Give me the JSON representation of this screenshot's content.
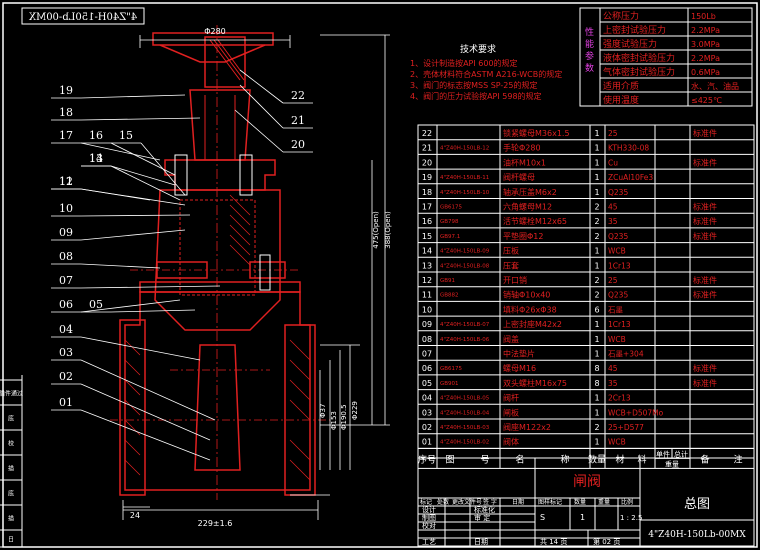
{
  "drawing_code": "4\"Z40H-150Lb-00MX",
  "drawing_code_mirrored": "4\"Z40H-150Lb-00MX",
  "tech_req": {
    "title": "技术要求",
    "items": [
      "1、设计制造按API 600的规定",
      "2、壳体材料符合ASTM A216-WCB的规定",
      "3、阀门的标志按MSS SP-25的规定",
      "4、阀门的压力试验按API 598的规定"
    ]
  },
  "perf": {
    "side_label": "性能参数",
    "rows": [
      [
        "公称压力",
        "150Lb"
      ],
      [
        "上密封试验压力",
        "2.2MPa"
      ],
      [
        "强度试验压力",
        "3.0MPa"
      ],
      [
        "液体密封试验压力",
        "2.2MPa"
      ],
      [
        "气体密封试验压力",
        "0.6MPa"
      ],
      [
        "适用介质",
        "水、汽、油品"
      ],
      [
        "使用温度",
        "≤425℃"
      ]
    ]
  },
  "bom": {
    "rows": [
      [
        "22",
        "",
        "锁紧螺母M36x1.5",
        "1",
        "25",
        "",
        "标准件"
      ],
      [
        "21",
        "4\"Z40H-150LB-12",
        "手轮Φ280",
        "1",
        "KTH330-08",
        "",
        ""
      ],
      [
        "20",
        "",
        "油杯M10x1",
        "1",
        "Cu",
        "",
        "标准件"
      ],
      [
        "19",
        "4\"Z40H-150LB-11",
        "阀杆螺母",
        "1",
        "ZCuAl10Fe3",
        "",
        ""
      ],
      [
        "18",
        "4\"Z40H-150LB-10",
        "轴承压盖M6x2",
        "1",
        "Q235",
        "",
        ""
      ],
      [
        "17",
        "GB6175",
        "六角螺母M12",
        "2",
        "45",
        "",
        "标准件"
      ],
      [
        "16",
        "GB798",
        "活节螺栓M12x65",
        "2",
        "35",
        "",
        "标准件"
      ],
      [
        "15",
        "GB97.1",
        "平垫圈Φ12",
        "2",
        "Q235",
        "",
        "标准件"
      ],
      [
        "14",
        "4\"Z40H-150LB-09",
        "压板",
        "1",
        "WCB",
        "",
        ""
      ],
      [
        "13",
        "4\"Z40H-150LB-08",
        "压套",
        "1",
        "1Cr13",
        "",
        ""
      ],
      [
        "12",
        "GB91",
        "开口销",
        "2",
        "25",
        "",
        "标准件"
      ],
      [
        "11",
        "GB882",
        "销轴Φ10x40",
        "2",
        "Q235",
        "",
        "标准件"
      ],
      [
        "10",
        "",
        "填料Φ26xΦ38",
        "6",
        "石墨",
        "",
        ""
      ],
      [
        "09",
        "4\"Z40H-150LB-07",
        "上密封座M42x2",
        "1",
        "1Cr13",
        "",
        ""
      ],
      [
        "08",
        "4\"Z40H-150LB-06",
        "阀盖",
        "1",
        "WCB",
        "",
        ""
      ],
      [
        "07",
        "",
        "中法垫片",
        "1",
        "石墨+304",
        "",
        ""
      ],
      [
        "06",
        "GB6175",
        "螺母M16",
        "8",
        "45",
        "",
        "标准件"
      ],
      [
        "05",
        "GB901",
        "双头螺柱M16x75",
        "8",
        "35",
        "",
        "标准件"
      ],
      [
        "04",
        "4\"Z40H-150LB-05",
        "阀杆",
        "1",
        "2Cr13",
        "",
        ""
      ],
      [
        "03",
        "4\"Z40H-150LB-04",
        "闸板",
        "1",
        "WCB+D507Mo",
        "",
        ""
      ],
      [
        "02",
        "4\"Z40H-150LB-03",
        "阀座M122x2",
        "2",
        "25+D577",
        "",
        ""
      ],
      [
        "01",
        "4\"Z40H-150LB-02",
        "阀体",
        "1",
        "WCB",
        "",
        ""
      ]
    ],
    "headers": [
      "序号",
      "图",
      "号",
      "名",
      "称",
      "数量",
      "材",
      "料",
      "单件",
      "总计",
      "重量",
      "备",
      "注"
    ]
  },
  "title_block": {
    "name": "闸阀",
    "type": "总图",
    "code": "4\"Z40H-150Lb-00MX",
    "marks_label": "标记",
    "count_label": "处数",
    "file_label": "更改文件号",
    "sign_label": "签 字",
    "date_label": "日期",
    "design": "设计",
    "draw": "制图",
    "check": "校对",
    "craft": "工艺",
    "std": "标准化",
    "review": "审 定",
    "approve": "日期",
    "stage_label": "图样标记",
    "qty_label": "数量",
    "weight_label": "重量",
    "scale_label": "比例",
    "stage_value": "S",
    "qty_value": "1",
    "scale_value": "1 : 2.5",
    "sheets": "共 14 页",
    "sheet": "第 02 页"
  },
  "left_strip": [
    "借件通过",
    "底",
    "校",
    "描",
    "底",
    "描",
    "日"
  ],
  "dims": {
    "handwheel": "Φ280",
    "height_open": "475(Open)",
    "height_closed": "388(Open)",
    "d1": "Φ37",
    "d2": "Φ153",
    "d3": "Φ190.5",
    "d4": "Φ229",
    "base_length": "229±1.6",
    "face": "24"
  },
  "balloons_left": [
    "19",
    "18",
    "17",
    "16",
    "15",
    "14",
    "13",
    "12",
    "11",
    "10",
    "09",
    "08",
    "07",
    "06",
    "05",
    "04",
    "03",
    "02",
    "01"
  ],
  "balloons_right": [
    "22",
    "21",
    "20"
  ]
}
